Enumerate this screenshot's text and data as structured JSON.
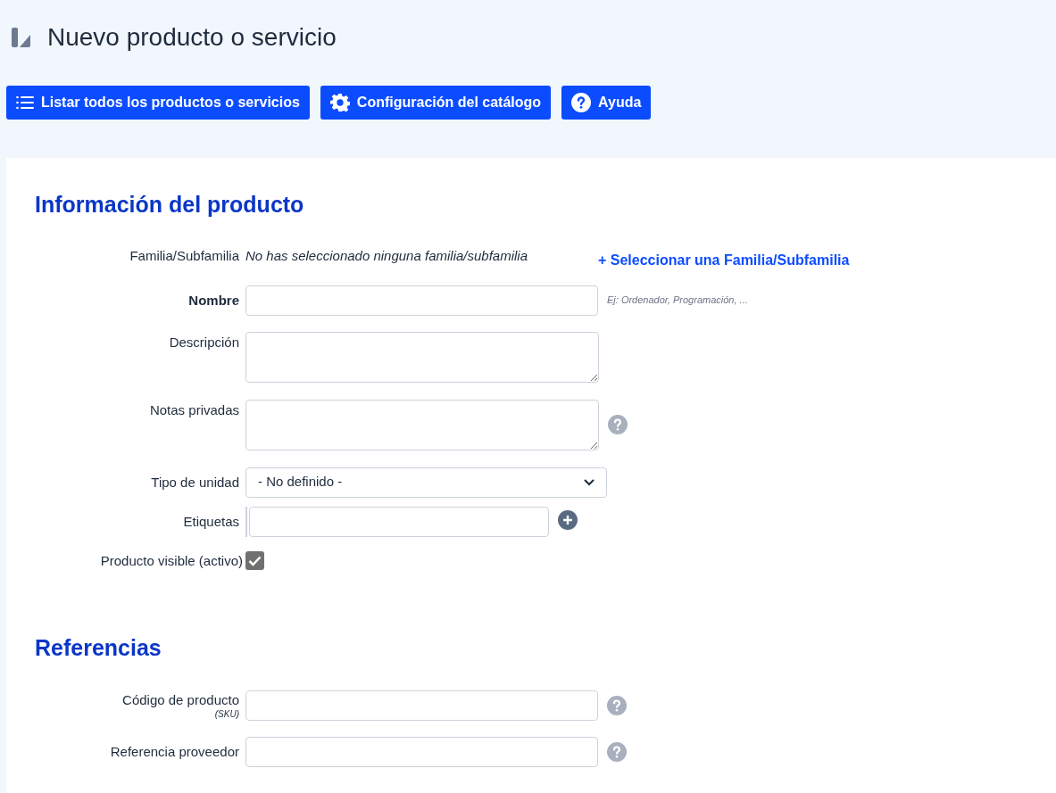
{
  "page_title": "Nuevo producto o servicio",
  "toolbar": [
    {
      "label": "Listar todos los productos o servicios",
      "kind": "list"
    },
    {
      "label": "Configuración del catálogo",
      "kind": "gear"
    },
    {
      "label": "Ayuda",
      "kind": "help"
    }
  ],
  "sections": [
    {
      "title": "Información del producto",
      "fields": [
        {
          "kind": "family",
          "label": "Familia/Subfamilia",
          "value": "No has seleccionado ninguna familia/subfamilia",
          "link": "+ Seleccionar una Familia/Subfamilia"
        },
        {
          "kind": "text",
          "label": "Nombre",
          "bold": true,
          "hint": "Ej: Ordenador, Programación, ...",
          "help": false
        },
        {
          "kind": "textarea",
          "label": "Descripción",
          "help": false
        },
        {
          "kind": "textarea",
          "label": "Notas privadas",
          "help": true
        },
        {
          "kind": "select",
          "label": "Tipo de unidad",
          "value": "- No definido -"
        },
        {
          "kind": "tags",
          "label": "Etiquetas"
        },
        {
          "kind": "checkbox",
          "label": "Producto visible (activo)",
          "checked": true
        }
      ]
    },
    {
      "title": "Referencias",
      "fields": [
        {
          "kind": "text",
          "label": "Código de producto",
          "sublabel": "(SKU)",
          "bold": false,
          "help": true
        },
        {
          "kind": "text",
          "label": "Referencia proveedor",
          "bold": false,
          "help": true
        }
      ]
    }
  ]
}
